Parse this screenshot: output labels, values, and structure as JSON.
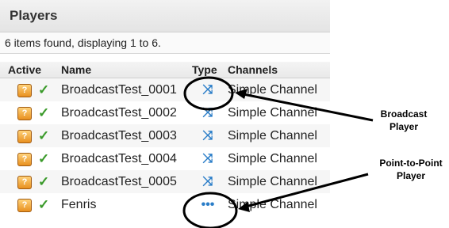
{
  "panel": {
    "title": "Players",
    "status": "6 items found, displaying 1 to 6.",
    "columns": {
      "active": "Active",
      "name": "Name",
      "type": "Type",
      "channels": "Channels"
    },
    "rows": [
      {
        "name": "BroadcastTest_0001",
        "type_icon": "broadcast-icon",
        "type_glyph": "⤨",
        "channel": "Simple Channel"
      },
      {
        "name": "BroadcastTest_0002",
        "type_icon": "broadcast-icon",
        "type_glyph": "⤨",
        "channel": "Simple Channel"
      },
      {
        "name": "BroadcastTest_0003",
        "type_icon": "broadcast-icon",
        "type_glyph": "⤨",
        "channel": "Simple Channel"
      },
      {
        "name": "BroadcastTest_0004",
        "type_icon": "broadcast-icon",
        "type_glyph": "⤨",
        "channel": "Simple Channel"
      },
      {
        "name": "BroadcastTest_0005",
        "type_icon": "broadcast-icon",
        "type_glyph": "⤨",
        "channel": "Simple Channel"
      },
      {
        "name": "Fenris",
        "type_icon": "point-to-point-icon",
        "type_glyph": "•••",
        "channel": "Simple Channel"
      }
    ],
    "help_glyph": "?",
    "check_glyph": "✓"
  },
  "callouts": {
    "broadcast_line1": "Broadcast",
    "broadcast_line2": "Player",
    "p2p_line1": "Point-to-Point",
    "p2p_line2": "Player"
  }
}
